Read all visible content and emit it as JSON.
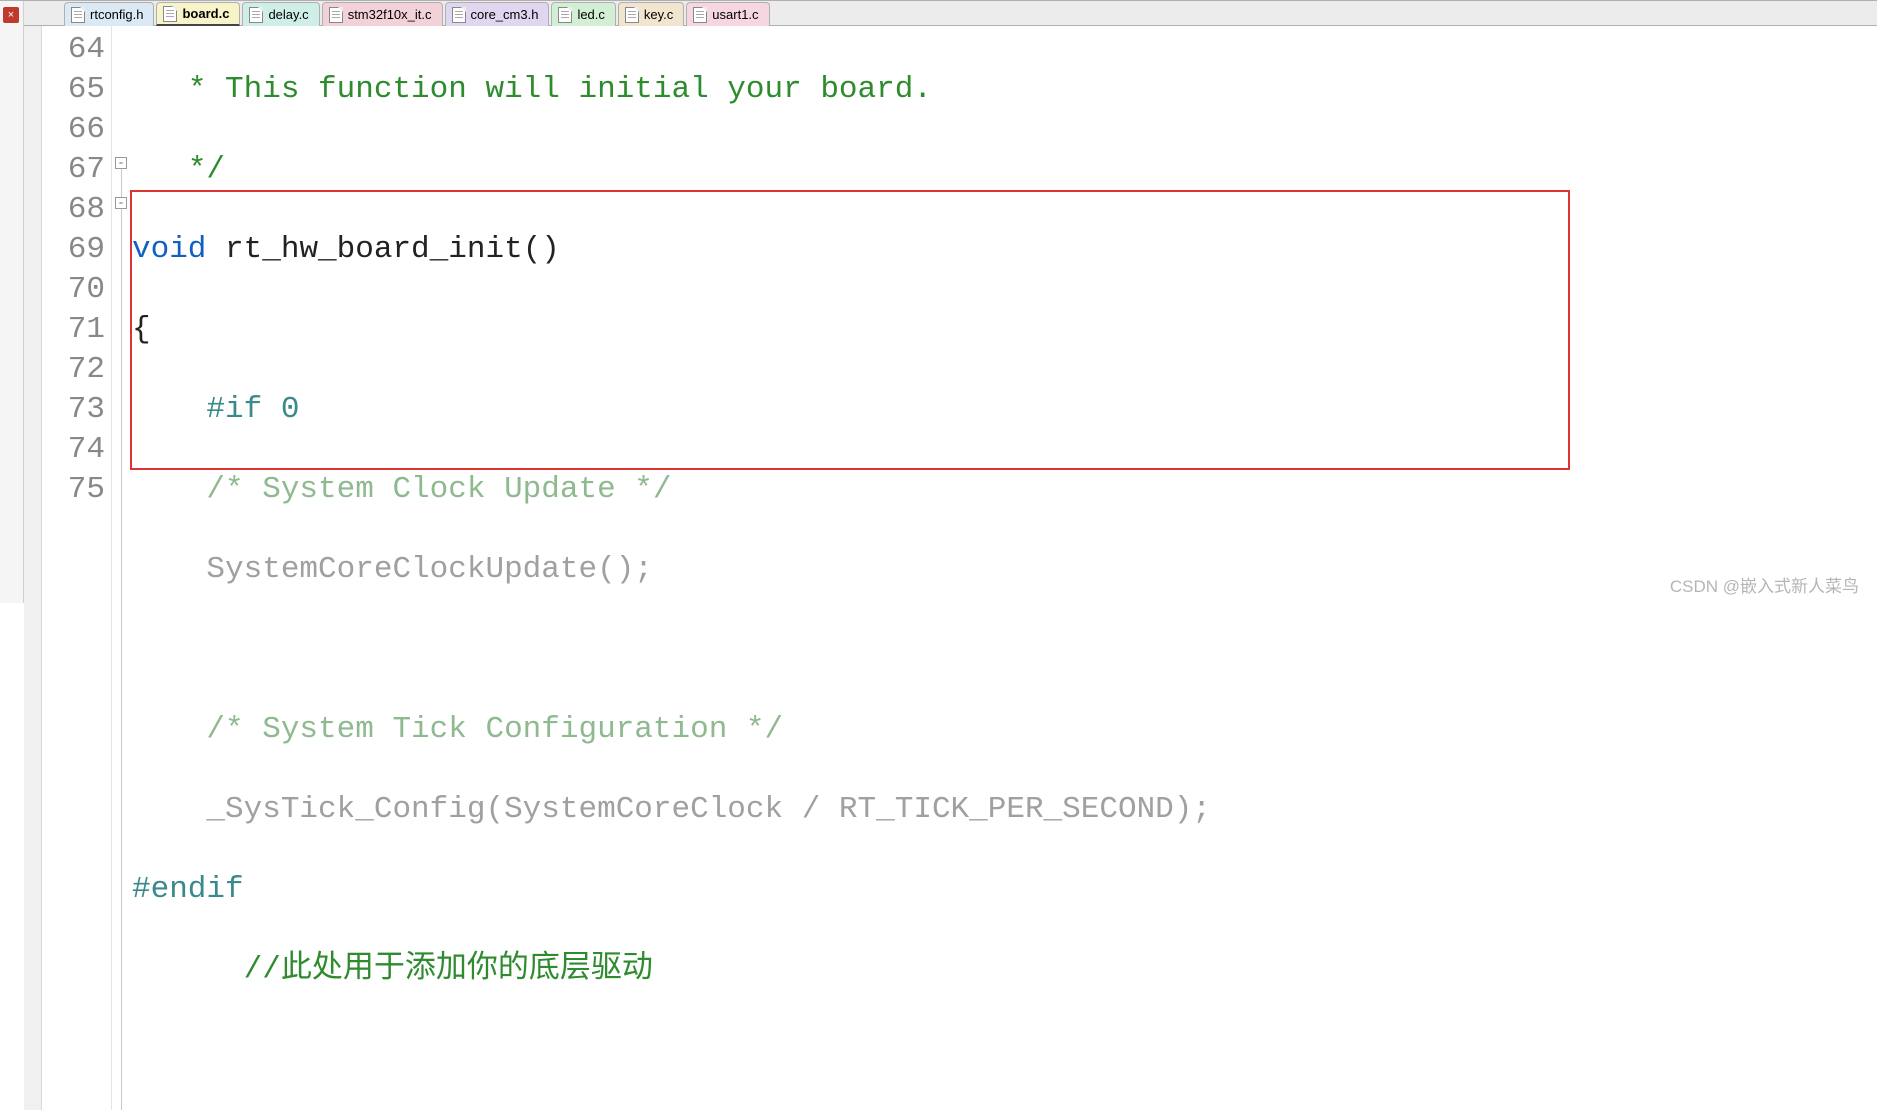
{
  "tabs": [
    {
      "label": "rtconfig.h",
      "color": "c-blue",
      "active": false
    },
    {
      "label": "board.c",
      "color": "c-yellow",
      "active": true
    },
    {
      "label": "delay.c",
      "color": "c-cyan",
      "active": false
    },
    {
      "label": "stm32f10x_it.c",
      "color": "c-pink",
      "active": false
    },
    {
      "label": "core_cm3.h",
      "color": "c-lav",
      "active": false
    },
    {
      "label": "led.c",
      "color": "c-mint",
      "active": false
    },
    {
      "label": "key.c",
      "color": "c-tan",
      "active": false
    },
    {
      "label": "usart1.c",
      "color": "c-rose",
      "active": false
    }
  ],
  "line_numbers": [
    "64",
    "65",
    "66",
    "67",
    "68",
    "69",
    "70",
    "71",
    "72",
    "73",
    "74",
    "75"
  ],
  "code": {
    "l64_pre": "   ",
    "l64_c": "* This function will initial your board.",
    "l65_pre": "   ",
    "l65_c": "*/",
    "l66_kw": "void",
    "l66_sp": " ",
    "l66_fn": "rt_hw_board_init",
    "l66_paren": "()",
    "l67": "{",
    "l68_ind": "    ",
    "l68_p": "#if 0",
    "l69_ind": "    ",
    "l69_c": "/* System Clock Update */",
    "l70_ind": "    ",
    "l70_s": "SystemCoreClockUpdate();",
    "l71": "",
    "l72_ind": "    ",
    "l72_c": "/* System Tick Configuration */",
    "l73_ind": "    ",
    "l73_s": "_SysTick_Config(SystemCoreClock / RT_TICK_PER_SECOND);",
    "l74_p": "#endif",
    "l75_ind": "      ",
    "l75_c": "//此处用于添加你的底层驱动"
  },
  "watermark": "CSDN @嵌入式新人菜鸟",
  "close_badge": "×"
}
